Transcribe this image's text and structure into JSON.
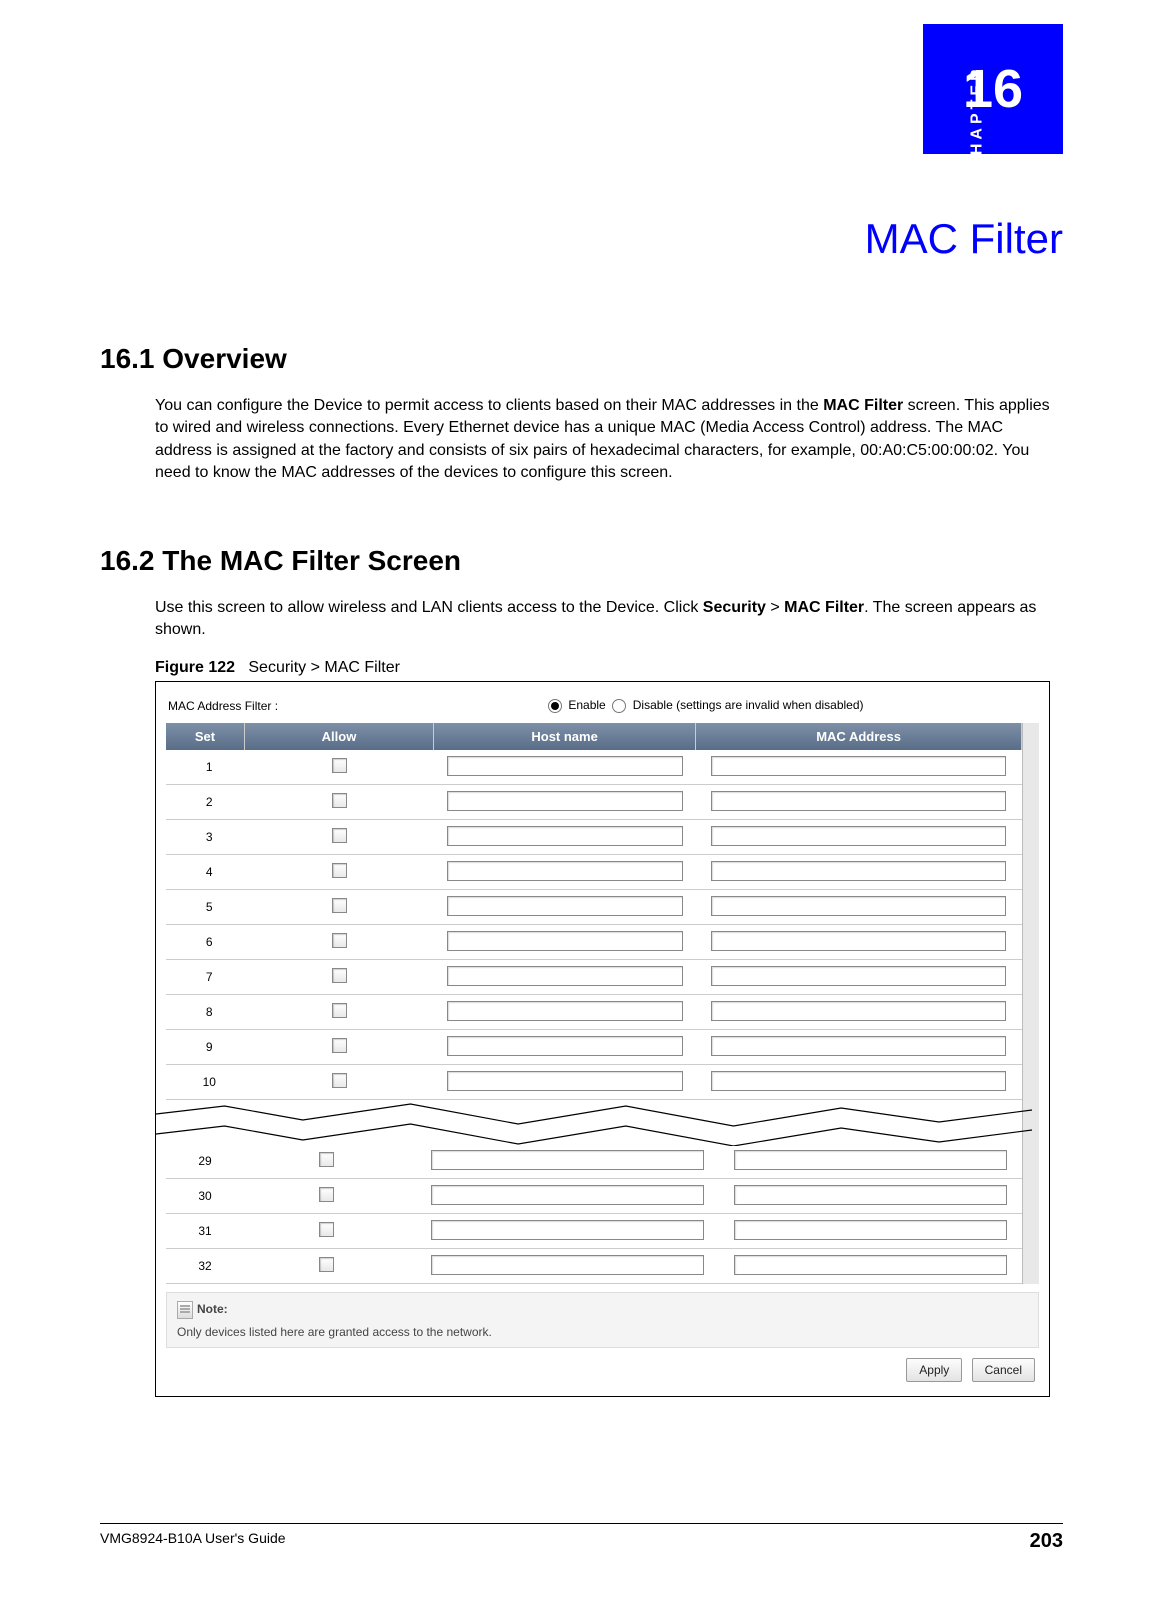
{
  "chapter": {
    "word": "CHAPTER",
    "number": "16",
    "title": "MAC Filter"
  },
  "s1": {
    "heading": "16.1  Overview",
    "para_parts": {
      "a": "You can configure the Device to permit access to clients based on their MAC addresses in the ",
      "b": "MAC Filter",
      "c": " screen. This applies to wired and wireless connections. Every Ethernet device has a unique MAC (Media Access Control) address. The MAC address is assigned at the factory and consists of six pairs of hexadecimal characters, for example, 00:A0:C5:00:00:02. You need to know the MAC addresses of the devices to configure this screen."
    }
  },
  "s2": {
    "heading": "16.2  The MAC Filter Screen",
    "para_parts": {
      "a": "Use this screen to allow wireless and LAN clients access to the Device. Click ",
      "b": "Security",
      "c": " > ",
      "d": "MAC Filter",
      "e": ". The screen appears as shown."
    }
  },
  "figure": {
    "label": "Figure 122",
    "caption": "Security > MAC Filter"
  },
  "screenshot": {
    "filter_label": "MAC Address Filter :",
    "enable": "Enable",
    "disable": "Disable (settings are invalid when disabled)",
    "headers": {
      "set": "Set",
      "allow": "Allow",
      "host": "Host name",
      "mac": "MAC Address"
    },
    "rows_top": [
      "1",
      "2",
      "3",
      "4",
      "5",
      "6",
      "7",
      "8",
      "9",
      "10"
    ],
    "rows_bottom": [
      "29",
      "30",
      "31",
      "32"
    ],
    "note_label": "Note:",
    "note_text": "Only devices listed here are granted access to the network.",
    "apply": "Apply",
    "cancel": "Cancel"
  },
  "footer": {
    "guide": "VMG8924-B10A User's Guide",
    "page": "203"
  }
}
